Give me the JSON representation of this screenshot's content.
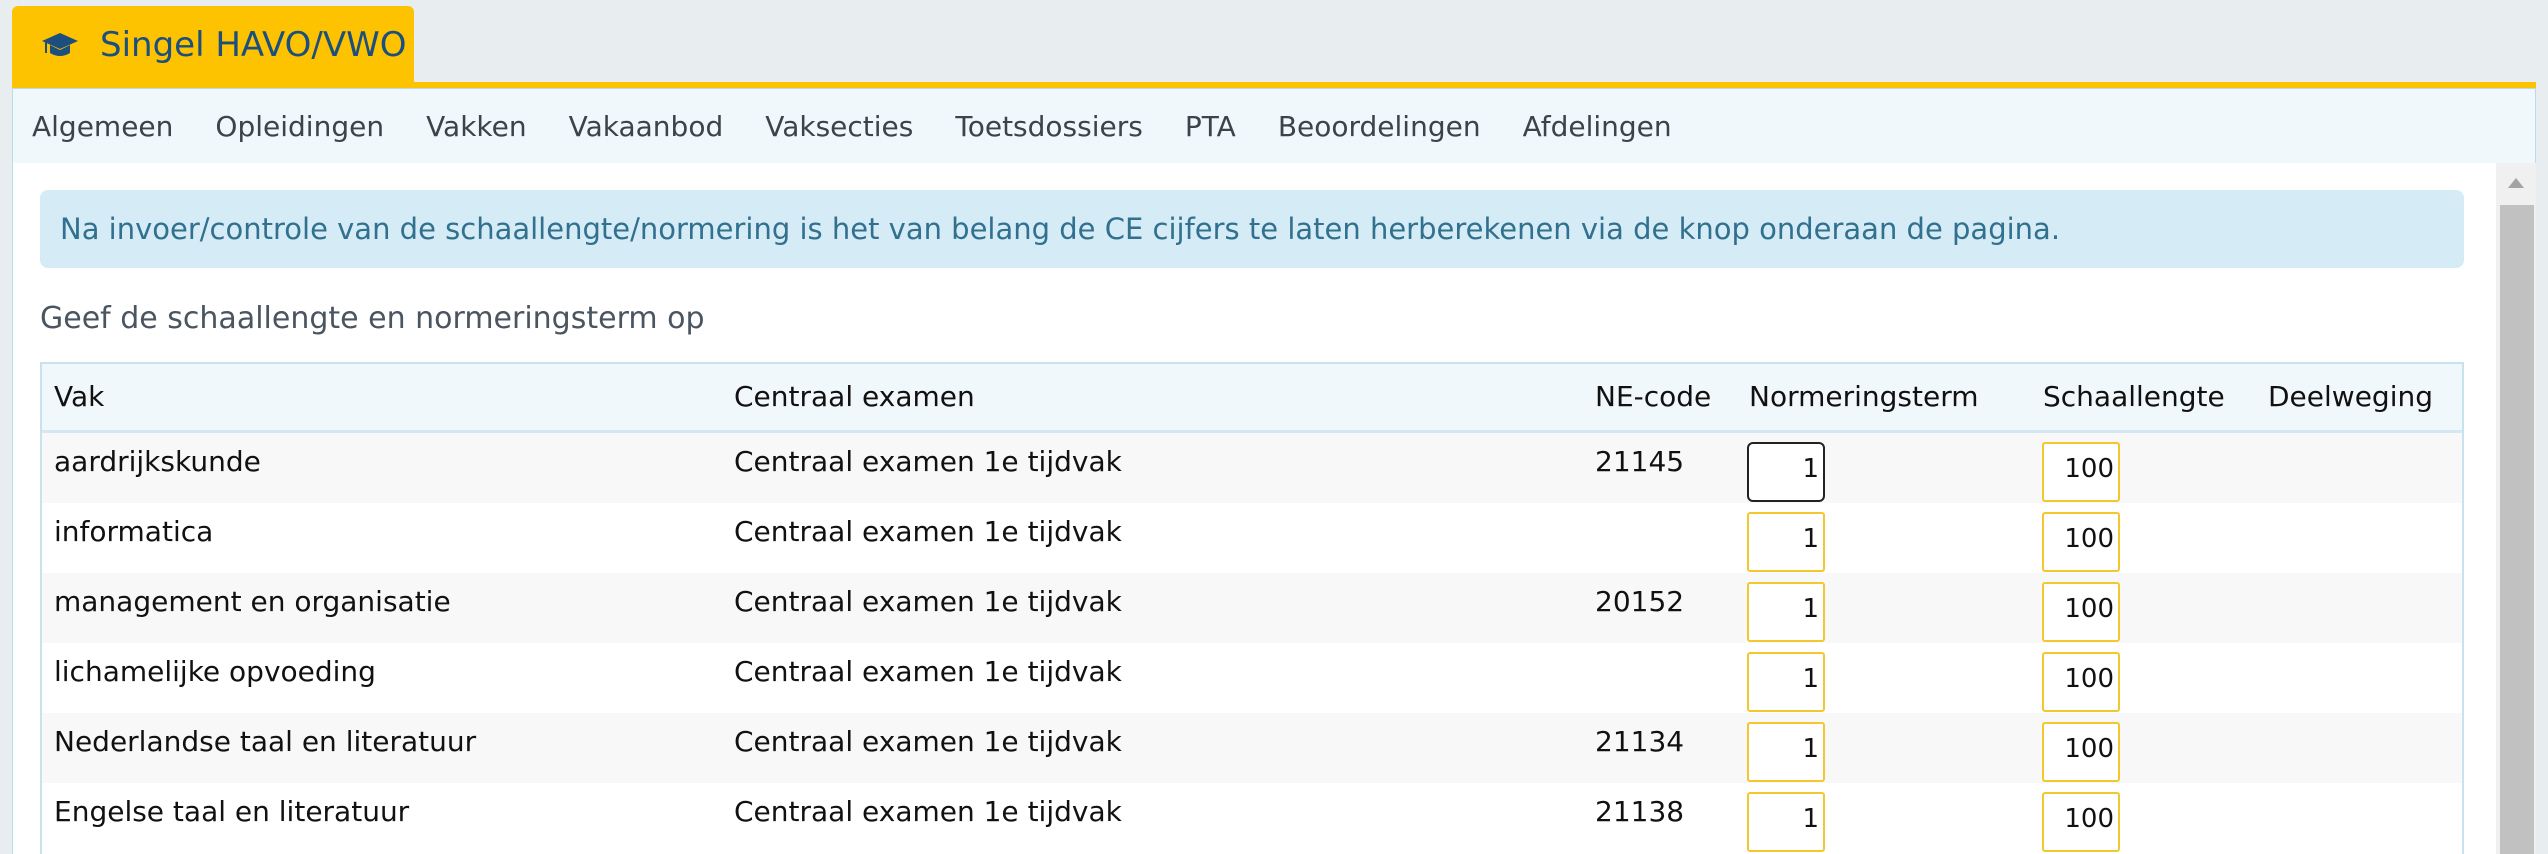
{
  "header": {
    "school_name": "Singel HAVO/VWO",
    "icon": "graduation-cap-icon"
  },
  "menu": {
    "items": [
      {
        "label": "Algemeen"
      },
      {
        "label": "Opleidingen"
      },
      {
        "label": "Vakken"
      },
      {
        "label": "Vakaanbod"
      },
      {
        "label": "Vaksecties"
      },
      {
        "label": "Toetsdossiers"
      },
      {
        "label": "PTA"
      },
      {
        "label": "Beoordelingen"
      },
      {
        "label": "Afdelingen"
      }
    ]
  },
  "alert": {
    "text": "Na invoer/controle van de schaallengte/normering is het van belang de CE cijfers te laten herberekenen via de knop onderaan de pagina."
  },
  "section": {
    "title": "Geef de schaallengte en normeringsterm op"
  },
  "table": {
    "columns": {
      "vak": "Vak",
      "centraal_examen": "Centraal examen",
      "ne_code": "NE-code",
      "normeringsterm": "Normeringsterm",
      "schaallengte": "Schaallengte",
      "deelweging": "Deelweging"
    },
    "rows": [
      {
        "vak": "aardrijkskunde",
        "ce": "Centraal examen 1e tijdvak",
        "ne_code": "21145",
        "normeringsterm": "1",
        "schaallengte": "100",
        "deelweging": ""
      },
      {
        "vak": "informatica",
        "ce": "Centraal examen 1e tijdvak",
        "ne_code": "",
        "normeringsterm": "1",
        "schaallengte": "100",
        "deelweging": ""
      },
      {
        "vak": "management en organisatie",
        "ce": "Centraal examen 1e tijdvak",
        "ne_code": "20152",
        "normeringsterm": "1",
        "schaallengte": "100",
        "deelweging": ""
      },
      {
        "vak": "lichamelijke opvoeding",
        "ce": "Centraal examen 1e tijdvak",
        "ne_code": "",
        "normeringsterm": "1",
        "schaallengte": "100",
        "deelweging": ""
      },
      {
        "vak": "Nederlandse taal en literatuur",
        "ce": "Centraal examen 1e tijdvak",
        "ne_code": "21134",
        "normeringsterm": "1",
        "schaallengte": "100",
        "deelweging": ""
      },
      {
        "vak": "Engelse taal en literatuur",
        "ce": "Centraal examen 1e tijdvak",
        "ne_code": "21138",
        "normeringsterm": "1",
        "schaallengte": "100",
        "deelweging": ""
      }
    ]
  },
  "colors": {
    "brand_yellow": "#fdc300",
    "brand_blue": "#1c4f7e",
    "alert_bg": "#d5ebf5",
    "alert_text": "#31708f",
    "input_border": "#f5c72e"
  }
}
